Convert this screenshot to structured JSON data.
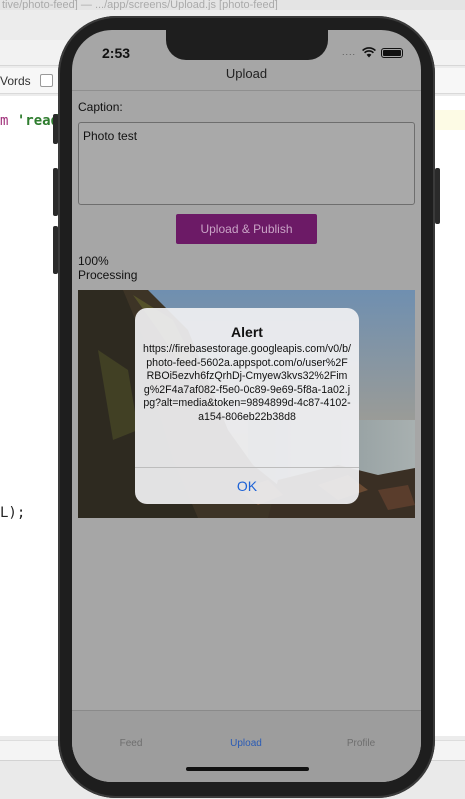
{
  "editor": {
    "title_fragment": "tive/photo-feed] — .../app/screens/Upload.js [photo-feed]",
    "words_label": "Vords",
    "code_line_1_kw": "m ",
    "code_line_1_str": "'read",
    "code_line_2": "L);"
  },
  "status_bar": {
    "time": "2:53",
    "signal_dots": "....",
    "icons": [
      "wifi-icon",
      "battery-icon"
    ]
  },
  "nav": {
    "title": "Upload"
  },
  "form": {
    "caption_label": "Caption:",
    "caption_value": "Photo test",
    "publish_label": "Upload & Publish",
    "progress": "100%",
    "status": "Processing"
  },
  "alert": {
    "title": "Alert",
    "message": "https://firebasestorage.googleapis.com/v0/b/photo-feed-5602a.appspot.com/o/user%2FRBOi5ezvh6fzQrhDj-Cmyew3kvs32%2Fimg%2F4a7af082-f5e0-0c89-9e69-5f8a-1a02.jpg?alt=media&token=9894899d-4c87-4102-a154-806eb22b38d8",
    "ok_label": "OK"
  },
  "tabs": [
    {
      "label": "Feed",
      "active": false
    },
    {
      "label": "Upload",
      "active": true
    },
    {
      "label": "Profile",
      "active": false
    }
  ],
  "colors": {
    "accent": "#6c1a66",
    "tab_active": "#2a5bb5",
    "alert_button": "#1d62d6"
  }
}
